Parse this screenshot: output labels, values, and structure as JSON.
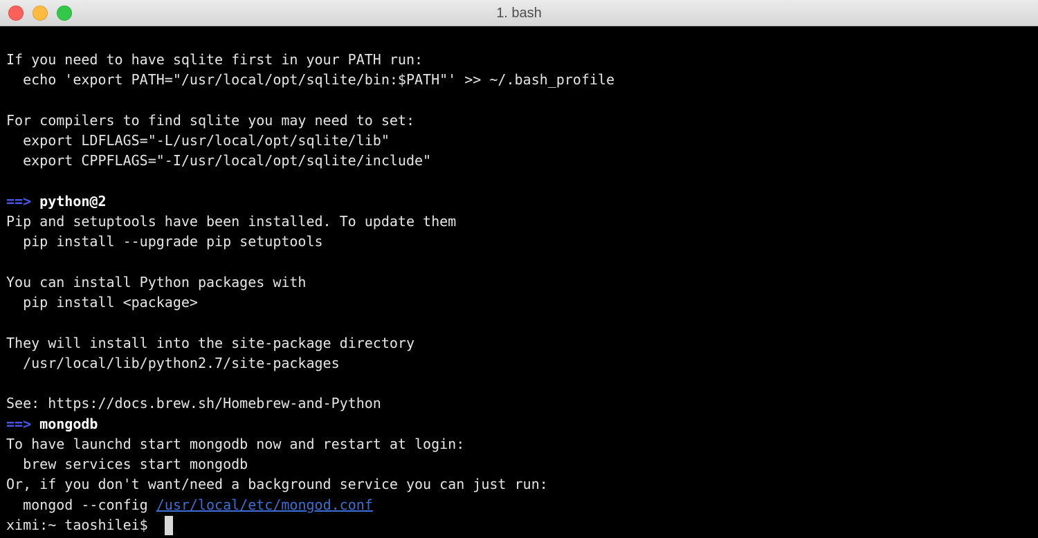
{
  "window": {
    "title": "1. bash"
  },
  "colors": {
    "terminal_bg": "#000000",
    "text": "#e6e6e6",
    "arrow": "#4a57e8",
    "link": "#3b6fd6",
    "close": "#fc605b",
    "minimize": "#fdbc40",
    "zoom": "#34c84a"
  },
  "terminal": {
    "lines": {
      "l1": "If you need to have sqlite first in your PATH run:",
      "l2": "  echo 'export PATH=\"/usr/local/opt/sqlite/bin:$PATH\"' >> ~/.bash_profile",
      "l3": "For compilers to find sqlite you may need to set:",
      "l4": "  export LDFLAGS=\"-L/usr/local/opt/sqlite/lib\"",
      "l5": "  export CPPFLAGS=\"-I/usr/local/opt/sqlite/include\"",
      "l6_arrow": "==>",
      "l6_pkg": "python@2",
      "l7": "Pip and setuptools have been installed. To update them",
      "l8": "  pip install --upgrade pip setuptools",
      "l9": "You can install Python packages with",
      "l10": "  pip install <package>",
      "l11": "They will install into the site-package directory",
      "l12": "  /usr/local/lib/python2.7/site-packages",
      "l13": "See: https://docs.brew.sh/Homebrew-and-Python",
      "l14_arrow": "==>",
      "l14_pkg": "mongodb",
      "l15": "To have launchd start mongodb now and restart at login:",
      "l16": "  brew services start mongodb",
      "l17": "Or, if you don't want/need a background service you can just run:",
      "l18_cmd": "  mongod --config ",
      "l18_link": "/usr/local/etc/mongod.conf",
      "prompt": "ximi:~ taoshilei$ "
    }
  }
}
